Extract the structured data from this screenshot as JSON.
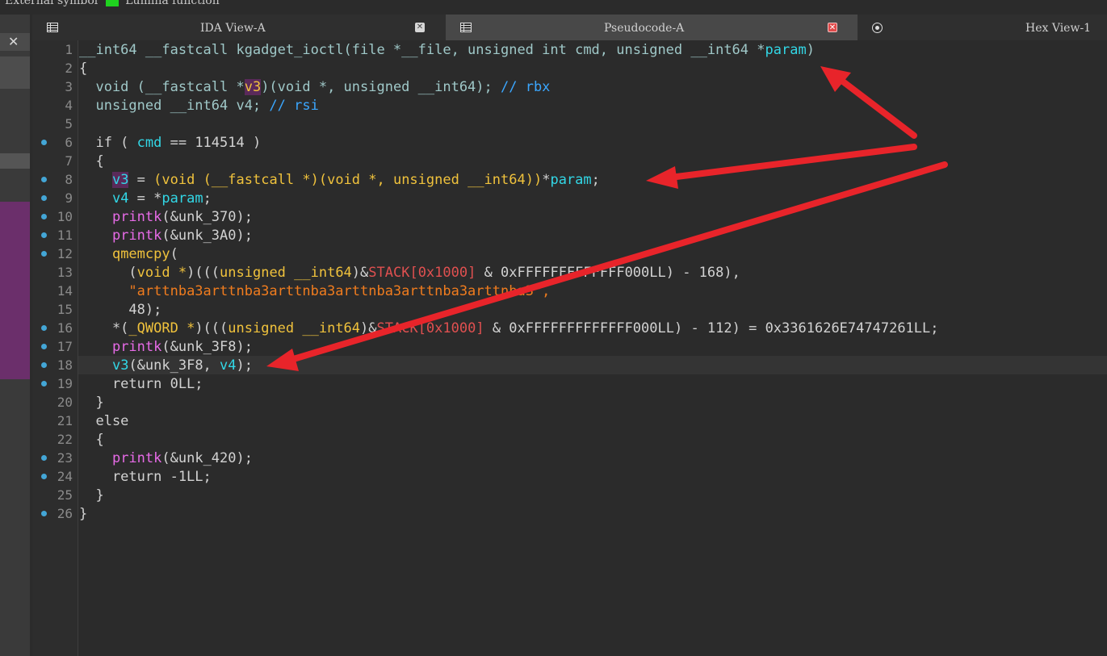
{
  "legend": {
    "external_symbol": "External symbol",
    "lumina_function": "Lumina function",
    "lumina_color": "#1fd31f"
  },
  "panel": {
    "close_glyph": "✕"
  },
  "tabs": [
    {
      "label": "IDA View-A",
      "icon": "table-icon",
      "close": "✕"
    },
    {
      "label": "Pseudocode-A",
      "icon": "table-icon",
      "close": "✕",
      "active": true
    },
    {
      "label": "Hex View-1",
      "icon": "hex-icon"
    }
  ],
  "code": {
    "lines": [
      {
        "n": "1",
        "dot": false
      },
      {
        "n": "2",
        "dot": false
      },
      {
        "n": "3",
        "dot": false
      },
      {
        "n": "4",
        "dot": false
      },
      {
        "n": "5",
        "dot": false
      },
      {
        "n": "6",
        "dot": true
      },
      {
        "n": "7",
        "dot": false
      },
      {
        "n": "8",
        "dot": true
      },
      {
        "n": "9",
        "dot": true
      },
      {
        "n": "10",
        "dot": true
      },
      {
        "n": "11",
        "dot": true
      },
      {
        "n": "12",
        "dot": true
      },
      {
        "n": "13",
        "dot": false
      },
      {
        "n": "14",
        "dot": false
      },
      {
        "n": "15",
        "dot": false
      },
      {
        "n": "16",
        "dot": true
      },
      {
        "n": "17",
        "dot": true
      },
      {
        "n": "18",
        "dot": true
      },
      {
        "n": "19",
        "dot": true
      },
      {
        "n": "20",
        "dot": false
      },
      {
        "n": "21",
        "dot": false
      },
      {
        "n": "22",
        "dot": false
      },
      {
        "n": "23",
        "dot": true
      },
      {
        "n": "24",
        "dot": true
      },
      {
        "n": "25",
        "dot": false
      },
      {
        "n": "26",
        "dot": true
      }
    ],
    "tokens": {
      "l1": [
        "__int64 __fastcall kgadget_ioctl(file *__file, unsigned int cmd, unsigned __int64 *",
        "param",
        ")"
      ],
      "l2": [
        "{"
      ],
      "l3": [
        "  void (__fastcall *",
        "v3",
        ")(void *, unsigned __int64); ",
        "// rbx"
      ],
      "l4": [
        "  unsigned __int64 v4; ",
        "// rsi"
      ],
      "l5": [
        ""
      ],
      "l6": [
        "  if ( ",
        "cmd",
        " == 114514 )"
      ],
      "l7": [
        "  {"
      ],
      "l8": [
        "    ",
        "v3",
        " = ",
        "(void (__fastcall *)(void *, unsigned __int64))",
        "*",
        "param",
        ";"
      ],
      "l9": [
        "    ",
        "v4",
        " = *",
        "param",
        ";"
      ],
      "l10": [
        "    ",
        "printk",
        "(&unk_370);"
      ],
      "l11": [
        "    ",
        "printk",
        "(&unk_3A0);"
      ],
      "l12": [
        "    ",
        "qmemcpy",
        "("
      ],
      "l13": [
        "      (",
        "void *",
        ")(((",
        "unsigned __int64",
        ")&",
        "STACK[0x1000]",
        " & 0xFFFFFFFFFFFFF000LL) - 168),"
      ],
      "l14": [
        "      \"",
        "arttnba3arttnba3arttnba3arttnba3arttnba3arttnba3",
        "\","
      ],
      "l15": [
        "      48);"
      ],
      "l16": [
        "    *(",
        "_QWORD *",
        ")(((",
        "unsigned __int64",
        ")&",
        "STACK[0x1000]",
        " & 0xFFFFFFFFFFFFF000LL) - 112) = 0x3361626E74747261LL;"
      ],
      "l17": [
        "    ",
        "printk",
        "(&unk_3F8);"
      ],
      "l18": [
        "    ",
        "v3",
        "(&unk_3F8, ",
        "v4",
        ");"
      ],
      "l19": [
        "    return 0LL;"
      ],
      "l20": [
        "  }"
      ],
      "l21": [
        "  else"
      ],
      "l22": [
        "  {"
      ],
      "l23": [
        "    ",
        "printk",
        "(&unk_420);"
      ],
      "l24": [
        "    return -1LL;"
      ],
      "l25": [
        "  }"
      ],
      "l26": [
        "}"
      ]
    }
  },
  "annotations": {
    "arrow_color": "#e8242a"
  }
}
